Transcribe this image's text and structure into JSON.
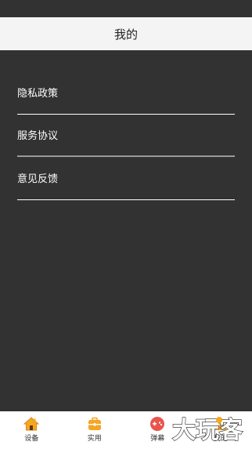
{
  "header": {
    "title": "我的"
  },
  "menu": {
    "items": [
      {
        "label": "隐私政策"
      },
      {
        "label": "服务协议"
      },
      {
        "label": "意见反馈"
      }
    ]
  },
  "tabbar": {
    "items": [
      {
        "label": "设备",
        "icon": "home-icon"
      },
      {
        "label": "实用",
        "icon": "toolbox-icon"
      },
      {
        "label": "弹幕",
        "icon": "gamepad-icon"
      },
      {
        "label": "我的",
        "icon": "profile-icon"
      }
    ]
  },
  "watermark": {
    "text": "大玩客"
  },
  "colors": {
    "background": "#323232",
    "header_bg": "#f4f4f4",
    "accent_orange": "#f5a623",
    "accent_red": "#e8554e",
    "tabbar_bg": "#ffffff"
  }
}
